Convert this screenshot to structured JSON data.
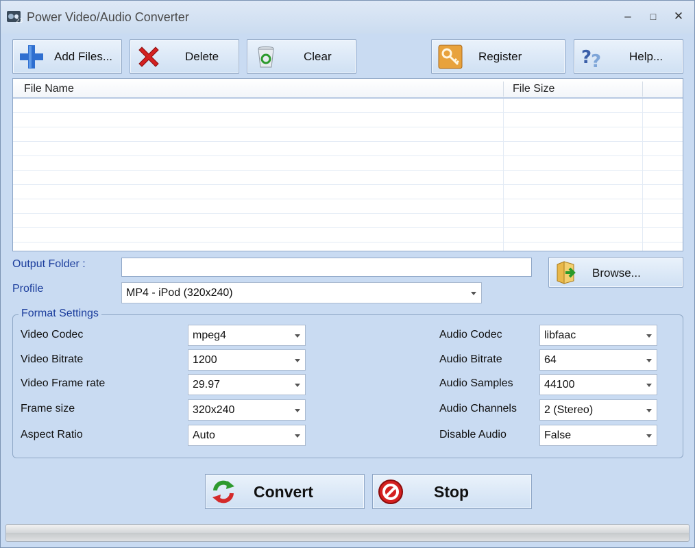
{
  "window": {
    "title": "Power Video/Audio Converter",
    "controls": {
      "minimize": "–",
      "maximize": "□",
      "close": "✕"
    }
  },
  "toolbar": {
    "add_files": "Add Files...",
    "delete": "Delete",
    "clear": "Clear",
    "register": "Register",
    "help": "Help..."
  },
  "file_list": {
    "columns": [
      "File Name",
      "File Size"
    ],
    "rows": []
  },
  "output": {
    "folder_label": "Output Folder :",
    "folder_value": "",
    "browse": "Browse...",
    "profile_label": "Profile",
    "profile_value": "MP4 - iPod (320x240)"
  },
  "format_settings": {
    "title": "Format Settings",
    "video": [
      {
        "label": "Video Codec",
        "value": "mpeg4"
      },
      {
        "label": "Video Bitrate",
        "value": "1200"
      },
      {
        "label": "Video Frame rate",
        "value": "29.97"
      },
      {
        "label": "Frame size",
        "value": "320x240"
      },
      {
        "label": "Aspect Ratio",
        "value": "Auto"
      }
    ],
    "audio": [
      {
        "label": "Audio Codec",
        "value": "libfaac"
      },
      {
        "label": "Audio Bitrate",
        "value": "64"
      },
      {
        "label": "Audio Samples",
        "value": "44100"
      },
      {
        "label": "Audio Channels",
        "value": "2 (Stereo)"
      },
      {
        "label": "Disable Audio",
        "value": "False"
      }
    ]
  },
  "actions": {
    "convert": "Convert",
    "stop": "Stop"
  },
  "progress": {
    "value": 0
  },
  "colors": {
    "accent_label": "#1a3c9c",
    "window_bg": "#c9dbf2"
  }
}
